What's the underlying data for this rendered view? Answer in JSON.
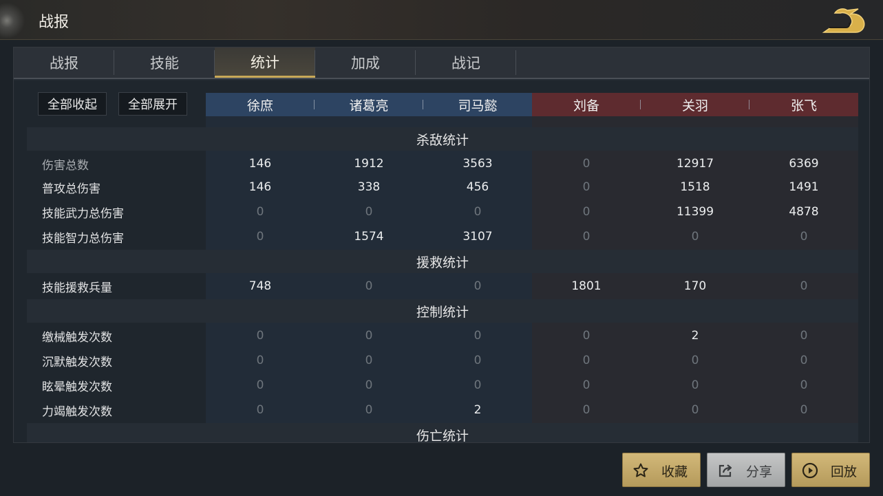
{
  "header": {
    "title": "战报"
  },
  "tabs": [
    {
      "label": "战报"
    },
    {
      "label": "技能"
    },
    {
      "label": "统计"
    },
    {
      "label": "加成"
    },
    {
      "label": "战记"
    }
  ],
  "active_tab": "统计",
  "controls": {
    "collapse_all": "全部收起",
    "expand_all": "全部展开"
  },
  "heroes": {
    "blue": [
      "徐庶",
      "诸葛亮",
      "司马懿"
    ],
    "red": [
      "刘备",
      "关羽",
      "张飞"
    ]
  },
  "sections": [
    {
      "title": "杀敌统计",
      "rows": [
        {
          "label": "伤害总数",
          "values": [
            "146",
            "1912",
            "3563",
            "0",
            "12917",
            "6369"
          ]
        },
        {
          "label": "普攻总伤害",
          "values": [
            "146",
            "338",
            "456",
            "0",
            "1518",
            "1491"
          ]
        },
        {
          "label": "技能武力总伤害",
          "values": [
            "0",
            "0",
            "0",
            "0",
            "11399",
            "4878"
          ]
        },
        {
          "label": "技能智力总伤害",
          "values": [
            "0",
            "1574",
            "3107",
            "0",
            "0",
            "0"
          ]
        }
      ]
    },
    {
      "title": "援救统计",
      "rows": [
        {
          "label": "技能援救兵量",
          "values": [
            "748",
            "0",
            "0",
            "1801",
            "170",
            "0"
          ]
        }
      ]
    },
    {
      "title": "控制统计",
      "rows": [
        {
          "label": "缴械触发次数",
          "values": [
            "0",
            "0",
            "0",
            "0",
            "2",
            "0"
          ]
        },
        {
          "label": "沉默触发次数",
          "values": [
            "0",
            "0",
            "0",
            "0",
            "0",
            "0"
          ]
        },
        {
          "label": "眩晕触发次数",
          "values": [
            "0",
            "0",
            "0",
            "0",
            "0",
            "0"
          ]
        },
        {
          "label": "力竭触发次数",
          "values": [
            "0",
            "0",
            "2",
            "0",
            "0",
            "0"
          ]
        }
      ]
    },
    {
      "title": "伤亡统计",
      "rows": []
    }
  ],
  "actions": {
    "favorite": "收藏",
    "share": "分享",
    "replay": "回放"
  },
  "colors": {
    "blue_team": "#2d4462",
    "red_team": "#5e2b2f",
    "accent_gold": "#c9a958"
  },
  "icons": {
    "close": "dragon-close-icon",
    "favorite": "star-icon",
    "share": "share-icon",
    "replay": "play-circle-icon"
  }
}
